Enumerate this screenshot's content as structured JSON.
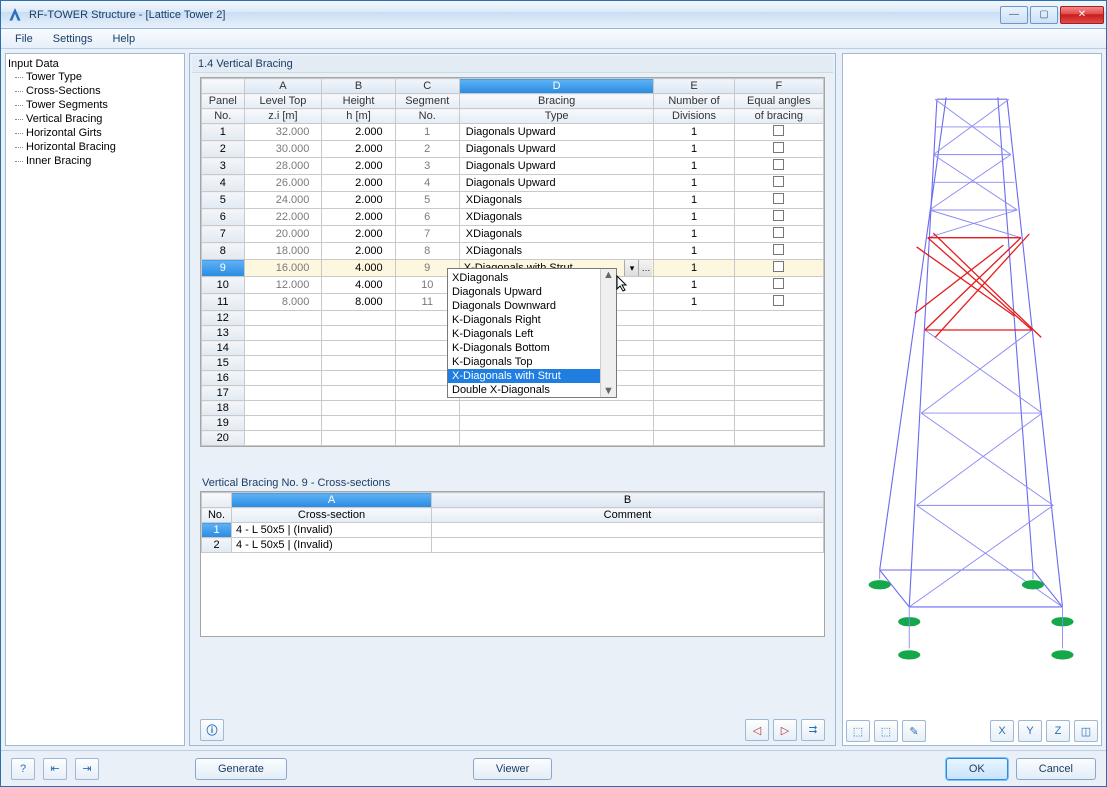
{
  "window": {
    "title": "RF-TOWER Structure - [Lattice Tower 2]"
  },
  "menu": {
    "file": "File",
    "settings": "Settings",
    "help": "Help"
  },
  "tree": {
    "root": "Input Data",
    "items": [
      "Tower Type",
      "Cross-Sections",
      "Tower Segments",
      "Vertical Bracing",
      "Horizontal Girts",
      "Horizontal Bracing",
      "Inner Bracing"
    ],
    "selected_index": 3
  },
  "section": {
    "title": "1.4 Vertical Bracing"
  },
  "table": {
    "letters": [
      "A",
      "B",
      "C",
      "D",
      "E",
      "F"
    ],
    "headers_row1": [
      "Panel",
      "Level Top",
      "Height",
      "Segment",
      "Bracing",
      "Number of",
      "Equal angles"
    ],
    "headers_row2": [
      "No.",
      "z.i [m]",
      "h [m]",
      "No.",
      "Type",
      "Divisions",
      "of bracing"
    ],
    "rows": [
      {
        "n": "1",
        "lt": "32.000",
        "h": "2.000",
        "seg": "1",
        "bt": "Diagonals Upward",
        "div": "1",
        "eq": ""
      },
      {
        "n": "2",
        "lt": "30.000",
        "h": "2.000",
        "seg": "2",
        "bt": "Diagonals Upward",
        "div": "1",
        "eq": ""
      },
      {
        "n": "3",
        "lt": "28.000",
        "h": "2.000",
        "seg": "3",
        "bt": "Diagonals Upward",
        "div": "1",
        "eq": ""
      },
      {
        "n": "4",
        "lt": "26.000",
        "h": "2.000",
        "seg": "4",
        "bt": "Diagonals Upward",
        "div": "1",
        "eq": ""
      },
      {
        "n": "5",
        "lt": "24.000",
        "h": "2.000",
        "seg": "5",
        "bt": "XDiagonals",
        "div": "1",
        "eq": ""
      },
      {
        "n": "6",
        "lt": "22.000",
        "h": "2.000",
        "seg": "6",
        "bt": "XDiagonals",
        "div": "1",
        "eq": ""
      },
      {
        "n": "7",
        "lt": "20.000",
        "h": "2.000",
        "seg": "7",
        "bt": "XDiagonals",
        "div": "1",
        "eq": ""
      },
      {
        "n": "8",
        "lt": "18.000",
        "h": "2.000",
        "seg": "8",
        "bt": "XDiagonals",
        "div": "1",
        "eq": ""
      },
      {
        "n": "9",
        "lt": "16.000",
        "h": "4.000",
        "seg": "9",
        "bt": "X-Diagonals with Strut",
        "div": "1",
        "eq": "",
        "selected": true,
        "dropdown": true
      },
      {
        "n": "10",
        "lt": "12.000",
        "h": "4.000",
        "seg": "10",
        "bt": "",
        "div": "1",
        "eq": ""
      },
      {
        "n": "11",
        "lt": "8.000",
        "h": "8.000",
        "seg": "11",
        "bt": "",
        "div": "1",
        "eq": ""
      },
      {
        "n": "12",
        "lt": "",
        "h": "",
        "seg": "",
        "bt": "",
        "div": "",
        "eq": "",
        "empty": true
      },
      {
        "n": "13",
        "lt": "",
        "h": "",
        "seg": "",
        "bt": "",
        "div": "",
        "eq": "",
        "empty": true
      },
      {
        "n": "14",
        "lt": "",
        "h": "",
        "seg": "",
        "bt": "",
        "div": "",
        "eq": "",
        "empty": true
      },
      {
        "n": "15",
        "lt": "",
        "h": "",
        "seg": "",
        "bt": "",
        "div": "",
        "eq": "",
        "empty": true
      },
      {
        "n": "16",
        "lt": "",
        "h": "",
        "seg": "",
        "bt": "",
        "div": "",
        "eq": "",
        "empty": true
      },
      {
        "n": "17",
        "lt": "",
        "h": "",
        "seg": "",
        "bt": "",
        "div": "",
        "eq": "",
        "empty": true
      },
      {
        "n": "18",
        "lt": "",
        "h": "",
        "seg": "",
        "bt": "",
        "div": "",
        "eq": "",
        "empty": true
      },
      {
        "n": "19",
        "lt": "",
        "h": "",
        "seg": "",
        "bt": "",
        "div": "",
        "eq": "",
        "empty": true
      },
      {
        "n": "20",
        "lt": "",
        "h": "",
        "seg": "",
        "bt": "",
        "div": "",
        "eq": "",
        "empty": true
      }
    ]
  },
  "dropdown": {
    "options": [
      "",
      "XDiagonals",
      "Diagonals Upward",
      "Diagonals Downward",
      "K-Diagonals Right",
      "K-Diagonals Left",
      "K-Diagonals Bottom",
      "K-Diagonals Top",
      "X-Diagonals with Strut",
      "Double X-Diagonals"
    ],
    "selected": "X-Diagonals with Strut"
  },
  "subsection": {
    "title": "Vertical Bracing No. 9  -  Cross-sections",
    "letters": [
      "A",
      "B"
    ],
    "headers": [
      "No.",
      "Cross-section",
      "Comment"
    ],
    "rows": [
      {
        "n": "1",
        "cs": "4 - L 50x5 | (Invalid)",
        "cm": ""
      },
      {
        "n": "2",
        "cs": "4 - L 50x5 | (Invalid)",
        "cm": ""
      }
    ]
  },
  "buttons": {
    "generate": "Generate",
    "viewer": "Viewer",
    "ok": "OK",
    "cancel": "Cancel"
  },
  "nav_icons": {
    "info": "ⓘ",
    "prev": "◁",
    "next": "▷",
    "goto": "⮆"
  },
  "bottom_icons": {
    "help": "?",
    "transfer1": "⇤",
    "transfer2": "⇥"
  },
  "right_icons": {
    "a": "⬚",
    "b": "⬚",
    "c": "✎",
    "x": "X",
    "y": "Y",
    "z": "Z",
    "iso": "◫"
  }
}
